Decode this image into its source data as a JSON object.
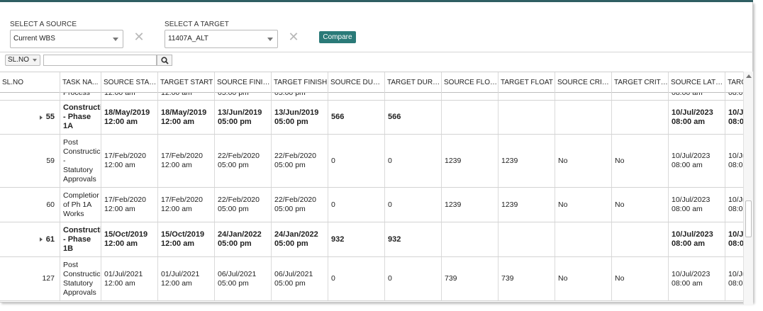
{
  "source": {
    "label": "SELECT A SOURCE",
    "value": "Current WBS"
  },
  "target": {
    "label": "SELECT A TARGET",
    "value": "11407A_ALT"
  },
  "compare_label": "Compare",
  "field_select": {
    "value": "SL.NO"
  },
  "search": {
    "value": ""
  },
  "columns": [
    "SL.NO",
    "TASK NA...",
    "SOURCE START",
    "TARGET START",
    "SOURCE FINISH",
    "TARGET FINISH",
    "SOURCE DURA...",
    "TARGET DURA...",
    "SOURCE FLOAT",
    "TARGET FLOAT",
    "SOURCE CRITI...",
    "TARGET CRITI...",
    "SOURCE LATE ...",
    "TARG"
  ],
  "rows": [
    {
      "bold": false,
      "expandable": false,
      "cells": [
        "",
        "Process",
        "12:00 am",
        "12:00 am",
        "05:00 pm",
        "05:00 pm",
        "",
        "",
        "",
        "",
        "",
        "",
        "08:00 am",
        "08:0"
      ]
    },
    {
      "bold": true,
      "expandable": true,
      "cells": [
        "55",
        "Constructic\n- Phase\n1A",
        "18/May/2019\n12:00 am",
        "18/May/2019\n12:00 am",
        "13/Jun/2019\n05:00 pm",
        "13/Jun/2019\n05:00 pm",
        "566",
        "566",
        "",
        "",
        "",
        "",
        "10/Jul/2023\n08:00 am",
        "10/Ju\n08:0"
      ]
    },
    {
      "bold": false,
      "expandable": false,
      "cells": [
        "59",
        "Post\nConstructic\n-\nStatutory\nApprovals",
        "17/Feb/2020\n12:00 am",
        "17/Feb/2020\n12:00 am",
        "22/Feb/2020\n05:00 pm",
        "22/Feb/2020\n05:00 pm",
        "0",
        "0",
        "1239",
        "1239",
        "No",
        "No",
        "10/Jul/2023\n08:00 am",
        "10/Ju\n08:0"
      ]
    },
    {
      "bold": false,
      "expandable": false,
      "cells": [
        "60",
        "Completior\nof Ph 1A\nWorks",
        "17/Feb/2020\n12:00 am",
        "17/Feb/2020\n12:00 am",
        "22/Feb/2020\n05:00 pm",
        "22/Feb/2020\n05:00 pm",
        "0",
        "0",
        "1239",
        "1239",
        "No",
        "No",
        "10/Jul/2023\n08:00 am",
        "10/Ju\n08:0"
      ]
    },
    {
      "bold": true,
      "expandable": true,
      "cells": [
        "61",
        "Constructic\n- Phase\n1B",
        "15/Oct/2019\n12:00 am",
        "15/Oct/2019\n12:00 am",
        "24/Jan/2022\n05:00 pm",
        "24/Jan/2022\n05:00 pm",
        "932",
        "932",
        "",
        "",
        "",
        "",
        "10/Jul/2023\n08:00 am",
        "10/Ju\n08:0"
      ]
    },
    {
      "bold": false,
      "expandable": false,
      "cells": [
        "127",
        "Post\nConstructic\nStatutory\nApprovals",
        "01/Jul/2021\n12:00 am",
        "01/Jul/2021\n12:00 am",
        "06/Jul/2021\n05:00 pm",
        "06/Jul/2021\n05:00 pm",
        "0",
        "0",
        "739",
        "739",
        "No",
        "No",
        "10/Jul/2023\n08:00 am",
        "10/Ju\n08:0"
      ]
    }
  ]
}
